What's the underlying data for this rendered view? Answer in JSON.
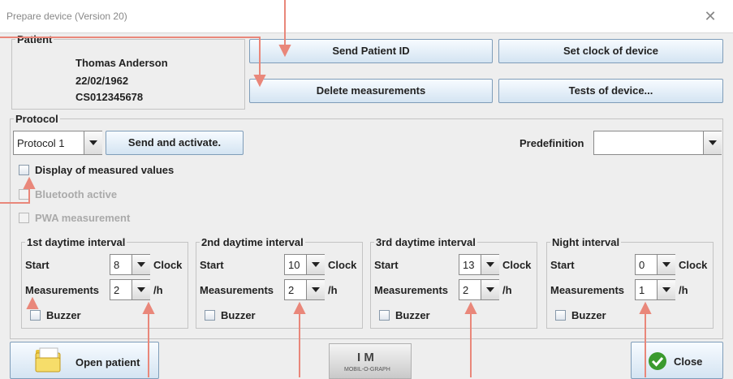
{
  "window": {
    "title": "Prepare device (Version 20)"
  },
  "patient": {
    "group_title": "Patient",
    "name": "Thomas Anderson",
    "dob": "22/02/1962",
    "id": "CS012345678"
  },
  "actions": {
    "send_patient_id": "Send Patient ID",
    "set_clock": "Set clock of device",
    "delete_measurements": "Delete measurements",
    "tests_of_device": "Tests of device..."
  },
  "protocol": {
    "group_title": "Protocol",
    "selected": "Protocol 1",
    "send_activate": "Send and activate.",
    "predefinition_label": "Predefinition",
    "predefinition_value": "",
    "display_measured": "Display of measured values",
    "bluetooth": "Bluetooth active",
    "pwa": "PWA measurement"
  },
  "intervals": [
    {
      "title": "1st daytime interval",
      "start_label": "Start",
      "start": "8",
      "clock": "Clock",
      "meas_label": "Measurements",
      "meas": "2",
      "unit": "/h",
      "buzzer": "Buzzer"
    },
    {
      "title": "2nd daytime interval",
      "start_label": "Start",
      "start": "10",
      "clock": "Clock",
      "meas_label": "Measurements",
      "meas": "2",
      "unit": "/h",
      "buzzer": "Buzzer"
    },
    {
      "title": "3rd daytime interval",
      "start_label": "Start",
      "start": "13",
      "clock": "Clock",
      "meas_label": "Measurements",
      "meas": "2",
      "unit": "/h",
      "buzzer": "Buzzer"
    },
    {
      "title": "Night interval",
      "start_label": "Start",
      "start": "0",
      "clock": "Clock",
      "meas_label": "Measurements",
      "meas": "1",
      "unit": "/h",
      "buzzer": "Buzzer"
    }
  ],
  "footer": {
    "open_patient": "Open patient",
    "logo_text": "I M",
    "logo_sub": "MOBIL-O-GRAPH",
    "close": "Close"
  },
  "colors": {
    "annotation": "#e9877a",
    "button_border": "#7f9db9",
    "close_check": "#3a9a2e"
  }
}
